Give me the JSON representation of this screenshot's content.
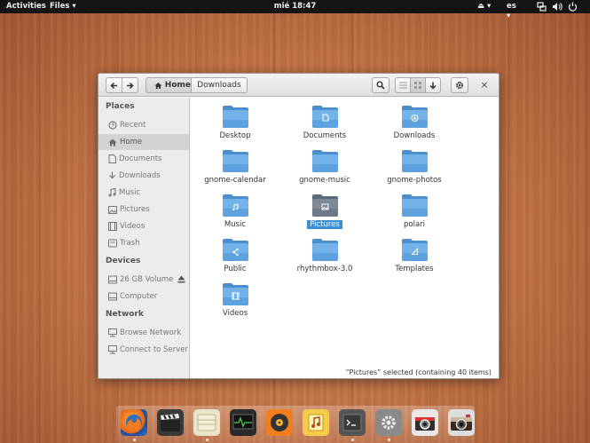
{
  "topbar": {
    "activities": "Activities",
    "app_menu": "Files ▾",
    "clock": "mié 18:47",
    "eject": "⏏ ▾",
    "language": "es ▾"
  },
  "window": {
    "breadcrumb": {
      "home": "Home",
      "downloads": "Downloads"
    },
    "close": "×"
  },
  "sidebar": {
    "places_header": "Places",
    "devices_header": "Devices",
    "network_header": "Network",
    "places": [
      {
        "label": "Recent",
        "icon": "clock-icon"
      },
      {
        "label": "Home",
        "icon": "home-icon"
      },
      {
        "label": "Documents",
        "icon": "document-icon"
      },
      {
        "label": "Downloads",
        "icon": "download-icon"
      },
      {
        "label": "Music",
        "icon": "music-icon"
      },
      {
        "label": "Pictures",
        "icon": "picture-icon"
      },
      {
        "label": "Videos",
        "icon": "video-icon"
      },
      {
        "label": "Trash",
        "icon": "trash-icon"
      }
    ],
    "devices": [
      {
        "label": "26 GB Volume",
        "icon": "drive-icon"
      },
      {
        "label": "Computer",
        "icon": "computer-icon"
      }
    ],
    "network": [
      {
        "label": "Browse Network",
        "icon": "network-icon"
      },
      {
        "label": "Connect to Server",
        "icon": "server-icon"
      }
    ]
  },
  "folders": [
    {
      "label": "Desktop",
      "emblem": ""
    },
    {
      "label": "Documents",
      "emblem": "document"
    },
    {
      "label": "Downloads",
      "emblem": "download"
    },
    {
      "label": "gnome-calendar",
      "emblem": ""
    },
    {
      "label": "gnome-music",
      "emblem": ""
    },
    {
      "label": "gnome-photos",
      "emblem": ""
    },
    {
      "label": "Music",
      "emblem": "music"
    },
    {
      "label": "Pictures",
      "emblem": "picture"
    },
    {
      "label": "polari",
      "emblem": ""
    },
    {
      "label": "Public",
      "emblem": "share"
    },
    {
      "label": "rhythmbox-3.0",
      "emblem": ""
    },
    {
      "label": "Templates",
      "emblem": "template"
    },
    {
      "label": "Videos",
      "emblem": "video"
    }
  ],
  "selected_folder": "Pictures",
  "status": "“Pictures” selected  (containing 40 items)",
  "dock": [
    {
      "name": "firefox",
      "icon": "firefox-icon"
    },
    {
      "name": "video-editor",
      "icon": "clapperboard-icon"
    },
    {
      "name": "files",
      "icon": "files-icon"
    },
    {
      "name": "system-monitor",
      "icon": "monitor-icon"
    },
    {
      "name": "music-player",
      "icon": "music-player-icon"
    },
    {
      "name": "audio-tag",
      "icon": "music-note-icon"
    },
    {
      "name": "terminal",
      "icon": "terminal-icon"
    },
    {
      "name": "settings",
      "icon": "gear-icon"
    },
    {
      "name": "camera",
      "icon": "camera-icon"
    },
    {
      "name": "photos",
      "icon": "photo-camera-icon"
    }
  ],
  "colors": {
    "folder_blue": "#6aaee8",
    "selection": "#3b8fd6",
    "topbar": "#141414"
  }
}
